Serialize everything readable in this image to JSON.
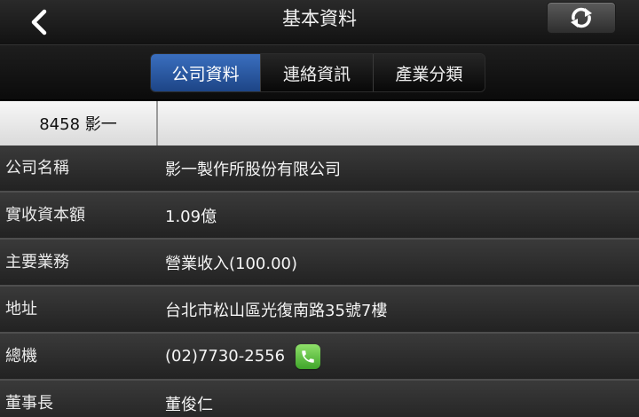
{
  "header": {
    "title": "基本資料",
    "back_icon": "back-chevron-icon",
    "refresh_icon": "refresh-icon"
  },
  "tabs": [
    {
      "label": "公司資料",
      "active": true
    },
    {
      "label": "連絡資訊",
      "active": false
    },
    {
      "label": "產業分類",
      "active": false
    }
  ],
  "stock": {
    "label": "8458 影一"
  },
  "rows": [
    {
      "label": "公司名稱",
      "value": "影一製作所股份有限公司"
    },
    {
      "label": "實收資本額",
      "value": "1.09億"
    },
    {
      "label": "主要業務",
      "value": "營業收入(100.00)"
    },
    {
      "label": "地址",
      "value": "台北市松山區光復南路35號7樓"
    },
    {
      "label": "總機",
      "value": "(02)7730-2556"
    },
    {
      "label": "董事長",
      "value": "董俊仁"
    }
  ],
  "colors": {
    "active_tab": "#2f5fae",
    "phone_icon": "#5cc43c"
  }
}
